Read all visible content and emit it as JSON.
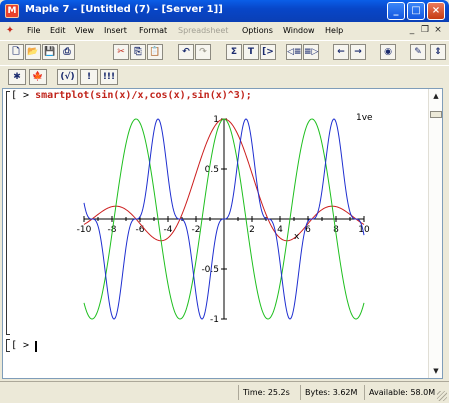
{
  "window": {
    "title": "Maple 7  - [Untitled (7) - [Server 1]]",
    "app_icon": "maple-leaf-icon",
    "controls": {
      "minimize": "_",
      "maximize": "□",
      "close": "×"
    }
  },
  "menubar": {
    "items": [
      {
        "label": "File",
        "enabled": true
      },
      {
        "label": "Edit",
        "enabled": true
      },
      {
        "label": "View",
        "enabled": true
      },
      {
        "label": "Insert",
        "enabled": true
      },
      {
        "label": "Format",
        "enabled": true
      },
      {
        "label": "Spreadsheet",
        "enabled": false
      },
      {
        "label": "Options",
        "enabled": true
      },
      {
        "label": "Window",
        "enabled": true
      },
      {
        "label": "Help",
        "enabled": true
      }
    ],
    "doc_controls": {
      "minimize": "_",
      "restore": "❐",
      "close": "×"
    }
  },
  "toolbar_main": {
    "buttons": [
      {
        "icon": "new-file-icon",
        "glyph": "🗋"
      },
      {
        "icon": "open-folder-icon",
        "glyph": "📂"
      },
      {
        "icon": "save-icon",
        "glyph": "💾"
      },
      {
        "icon": "print-icon",
        "glyph": "⎙"
      },
      {
        "icon": "cut-icon",
        "glyph": "✂"
      },
      {
        "icon": "copy-icon",
        "glyph": "⎘"
      },
      {
        "icon": "paste-icon",
        "glyph": "📋"
      },
      {
        "icon": "undo-icon",
        "glyph": "↶"
      },
      {
        "icon": "redo-icon",
        "glyph": "↷"
      },
      {
        "icon": "sigma-icon",
        "glyph": "Σ"
      },
      {
        "icon": "text-icon",
        "glyph": "T"
      },
      {
        "icon": "prompt-icon",
        "glyph": "[>"
      },
      {
        "icon": "group-outdent-icon",
        "glyph": "◁≡"
      },
      {
        "icon": "group-indent-icon",
        "glyph": "≡▷"
      },
      {
        "icon": "back-icon",
        "glyph": "←"
      },
      {
        "icon": "forward-icon",
        "glyph": "→"
      },
      {
        "icon": "stop-icon",
        "glyph": "◉"
      },
      {
        "icon": "pencil-icon",
        "glyph": "✎"
      },
      {
        "icon": "zoom-icon",
        "glyph": "⇕"
      }
    ]
  },
  "toolbar_context": {
    "buttons": [
      {
        "icon": "maple-input-icon",
        "glyph": "✱"
      },
      {
        "icon": "maple-leaf-icon",
        "glyph": "🍁"
      },
      {
        "icon": "execute-icon",
        "glyph": "(√)"
      },
      {
        "icon": "execute-all-icon",
        "glyph": "!"
      },
      {
        "icon": "execute-worksheet-icon",
        "glyph": "!!!"
      }
    ]
  },
  "worksheet": {
    "prompt": "[ >",
    "command": "smartplot(sin(x)/x,cos(x),sin(x)^3);",
    "next_prompt": "[ >"
  },
  "plot": {
    "y_axis_label": "1ve",
    "x_axis_label": "x",
    "x_ticks": [
      "-10",
      "-8",
      "-6",
      "-4",
      "-2",
      "2",
      "4",
      "6",
      "8",
      "10"
    ],
    "y_ticks": [
      "1",
      "0.5",
      "-0.5",
      "-1"
    ],
    "colors": {
      "sinc": "#cc1e1e",
      "cos": "#1fbf1f",
      "sin_cubed": "#1f2fd0"
    }
  },
  "chart_data": {
    "type": "line",
    "title": "",
    "xlabel": "x",
    "ylabel": "",
    "xlim": [
      -10,
      10
    ],
    "ylim": [
      -1,
      1
    ],
    "grid": false,
    "series": [
      {
        "expr": "sin(x)/x",
        "color": "#cc1e1e",
        "samples": [
          [
            -10,
            -0.054
          ],
          [
            -8,
            0.124
          ],
          [
            -6,
            0.047
          ],
          [
            -4,
            -0.189
          ],
          [
            -2,
            0.455
          ],
          [
            0,
            1.0
          ],
          [
            2,
            0.455
          ],
          [
            4,
            -0.189
          ],
          [
            6,
            0.047
          ],
          [
            8,
            0.124
          ],
          [
            10,
            -0.054
          ]
        ]
      },
      {
        "expr": "cos(x)",
        "color": "#1fbf1f",
        "samples": [
          [
            -10,
            -0.839
          ],
          [
            -8,
            -0.146
          ],
          [
            -6,
            0.96
          ],
          [
            -4,
            -0.654
          ],
          [
            -2,
            -0.416
          ],
          [
            0,
            1.0
          ],
          [
            2,
            -0.416
          ],
          [
            4,
            -0.654
          ],
          [
            6,
            0.96
          ],
          [
            8,
            -0.146
          ],
          [
            10,
            -0.839
          ]
        ]
      },
      {
        "expr": "sin(x)^3",
        "color": "#1f2fd0",
        "samples": [
          [
            -10,
            0.161
          ],
          [
            -8,
            -0.935
          ],
          [
            -6,
            0.022
          ],
          [
            -4,
            -0.433
          ],
          [
            -2,
            -0.752
          ],
          [
            0,
            0.0
          ],
          [
            2,
            0.752
          ],
          [
            4,
            0.433
          ],
          [
            6,
            -0.022
          ],
          [
            8,
            0.935
          ],
          [
            10,
            -0.161
          ]
        ]
      }
    ]
  },
  "statusbar": {
    "time": "Time: 25.2s",
    "bytes": "Bytes: 3.62M",
    "available": "Available: 58.0M"
  }
}
